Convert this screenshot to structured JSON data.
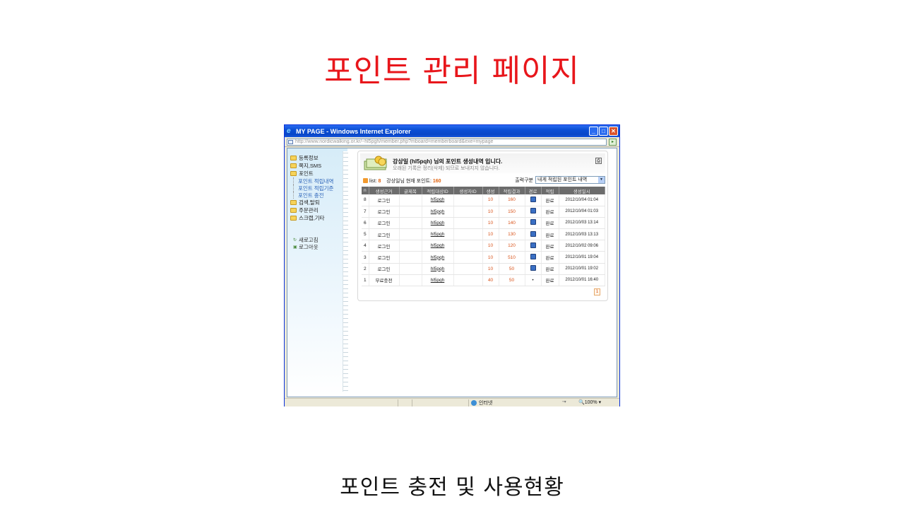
{
  "slide": {
    "title": "포인트 관리 페이지",
    "caption": "포인트 충전 및 사용현황"
  },
  "browser": {
    "window_title": "MY PAGE - Windows Internet Explorer",
    "address": "http://www.nordicwalking.or.kr/~hl5pgh/member.php?mboard=memberboard&exe=mypage",
    "status_zone": "인터넷",
    "zoom": "100%"
  },
  "sidebar": {
    "items": [
      {
        "label": "등록정보"
      },
      {
        "label": "쪽지,SMS"
      },
      {
        "label": "포인트"
      },
      {
        "label": "검색,탈퇴"
      },
      {
        "label": "주문관리"
      },
      {
        "label": "스크랩,기타"
      }
    ],
    "point_submenu": [
      "포인트 적립내역",
      "포인트 적립기준",
      "포인트 충전"
    ],
    "utils": [
      "새로고침",
      "로그아웃"
    ]
  },
  "panel": {
    "title": "강상일 (hl5pqh) 님의 포인트 생성내역 입니다.",
    "subtitle": "오래된 기록은 정리(삭제) 되므로 보내지지 않습니다.",
    "list_label": "list:",
    "list_count": "8",
    "current_points_label": "강상일님 현재 포인트:",
    "current_points": "160",
    "filter_label": "출력구분",
    "filter_value": "내게 적립된 포인트 내역",
    "page": "1"
  },
  "table": {
    "headers": [
      "n",
      "생성근거",
      "글제목",
      "적립대상ID",
      "생성자ID",
      "생성",
      "적립결과",
      "경로",
      "적립",
      "생성일시"
    ],
    "rows": [
      {
        "n": "8",
        "reason": "로그인",
        "subject": "",
        "target": "hl5pqh",
        "creator": "",
        "amount": "10",
        "result": "160",
        "route": "icon",
        "status": "완료",
        "date": "2012/10/04 01:04"
      },
      {
        "n": "7",
        "reason": "로그인",
        "subject": "",
        "target": "hl5pqh",
        "creator": "",
        "amount": "10",
        "result": "150",
        "route": "icon",
        "status": "완료",
        "date": "2012/10/04 01:03"
      },
      {
        "n": "6",
        "reason": "로그인",
        "subject": "",
        "target": "hl5pqh",
        "creator": "",
        "amount": "10",
        "result": "140",
        "route": "icon",
        "status": "완료",
        "date": "2012/10/03 13:14"
      },
      {
        "n": "5",
        "reason": "로그인",
        "subject": "",
        "target": "hl5pqh",
        "creator": "",
        "amount": "10",
        "result": "130",
        "route": "icon",
        "status": "완료",
        "date": "2012/10/03 13:13"
      },
      {
        "n": "4",
        "reason": "로그인",
        "subject": "",
        "target": "hl5pqh",
        "creator": "",
        "amount": "10",
        "result": "120",
        "route": "icon",
        "status": "완료",
        "date": "2012/10/02 09:06"
      },
      {
        "n": "3",
        "reason": "로그인",
        "subject": "",
        "target": "hl5pqh",
        "creator": "",
        "amount": "10",
        "result": "510",
        "route": "icon",
        "status": "완료",
        "date": "2012/10/01 19:04"
      },
      {
        "n": "2",
        "reason": "로그인",
        "subject": "",
        "target": "hl5pqh",
        "creator": "",
        "amount": "10",
        "result": "50",
        "route": "icon",
        "status": "완료",
        "date": "2012/10/01 19:02"
      },
      {
        "n": "1",
        "reason": "무료충전",
        "subject": "",
        "target": "hl5pqh",
        "creator": "",
        "amount": "40",
        "result": "50",
        "route": "•",
        "status": "완료",
        "date": "2012/10/01 16:40"
      }
    ]
  },
  "colors": {
    "title_red": "#e8161b",
    "xp_blue": "#0a4ed4",
    "accent_orange": "#e0620d",
    "header_gray": "#6c6c6c"
  }
}
